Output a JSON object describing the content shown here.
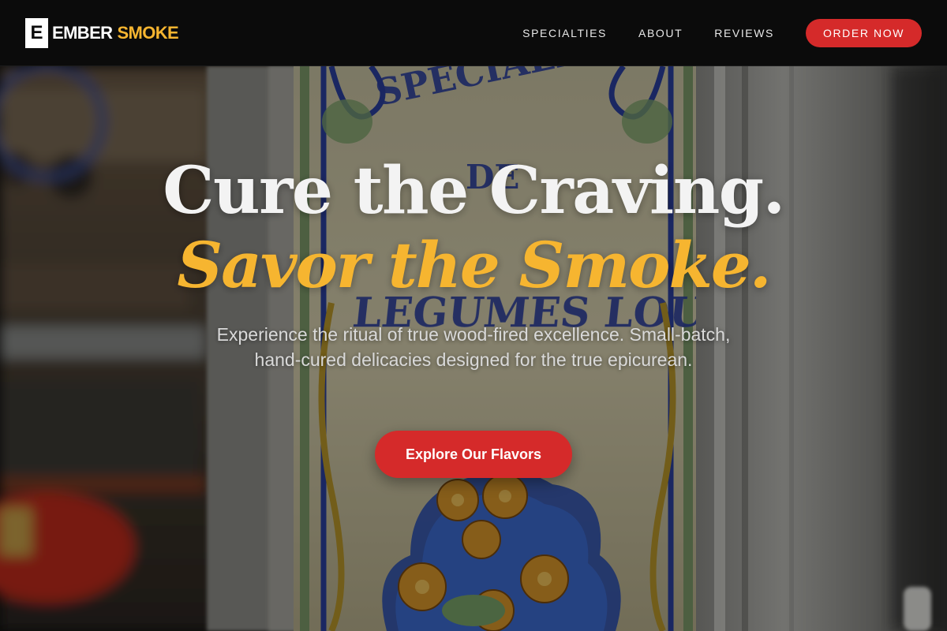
{
  "brand": {
    "mark": "E",
    "word_primary": "EMBER",
    "word_accent": "SMOKE"
  },
  "nav": {
    "items": [
      {
        "label": "SPECIALTIES"
      },
      {
        "label": "ABOUT"
      },
      {
        "label": "REVIEWS"
      }
    ],
    "cta_label": "ORDER NOW"
  },
  "hero": {
    "headline": "Cure the Craving.",
    "subheadline": "Savor the Smoke.",
    "lead": "Experience the ritual of true wood-fired excellence. Small-batch, hand-cured delicacies designed for the true epicurean.",
    "cta_label": "Explore Our Flavors"
  },
  "colors": {
    "accent_gold": "#f6b530",
    "accent_red": "#d52a2a",
    "nav_background": "#0b0b0b",
    "headline_white": "#f3f3f3"
  }
}
